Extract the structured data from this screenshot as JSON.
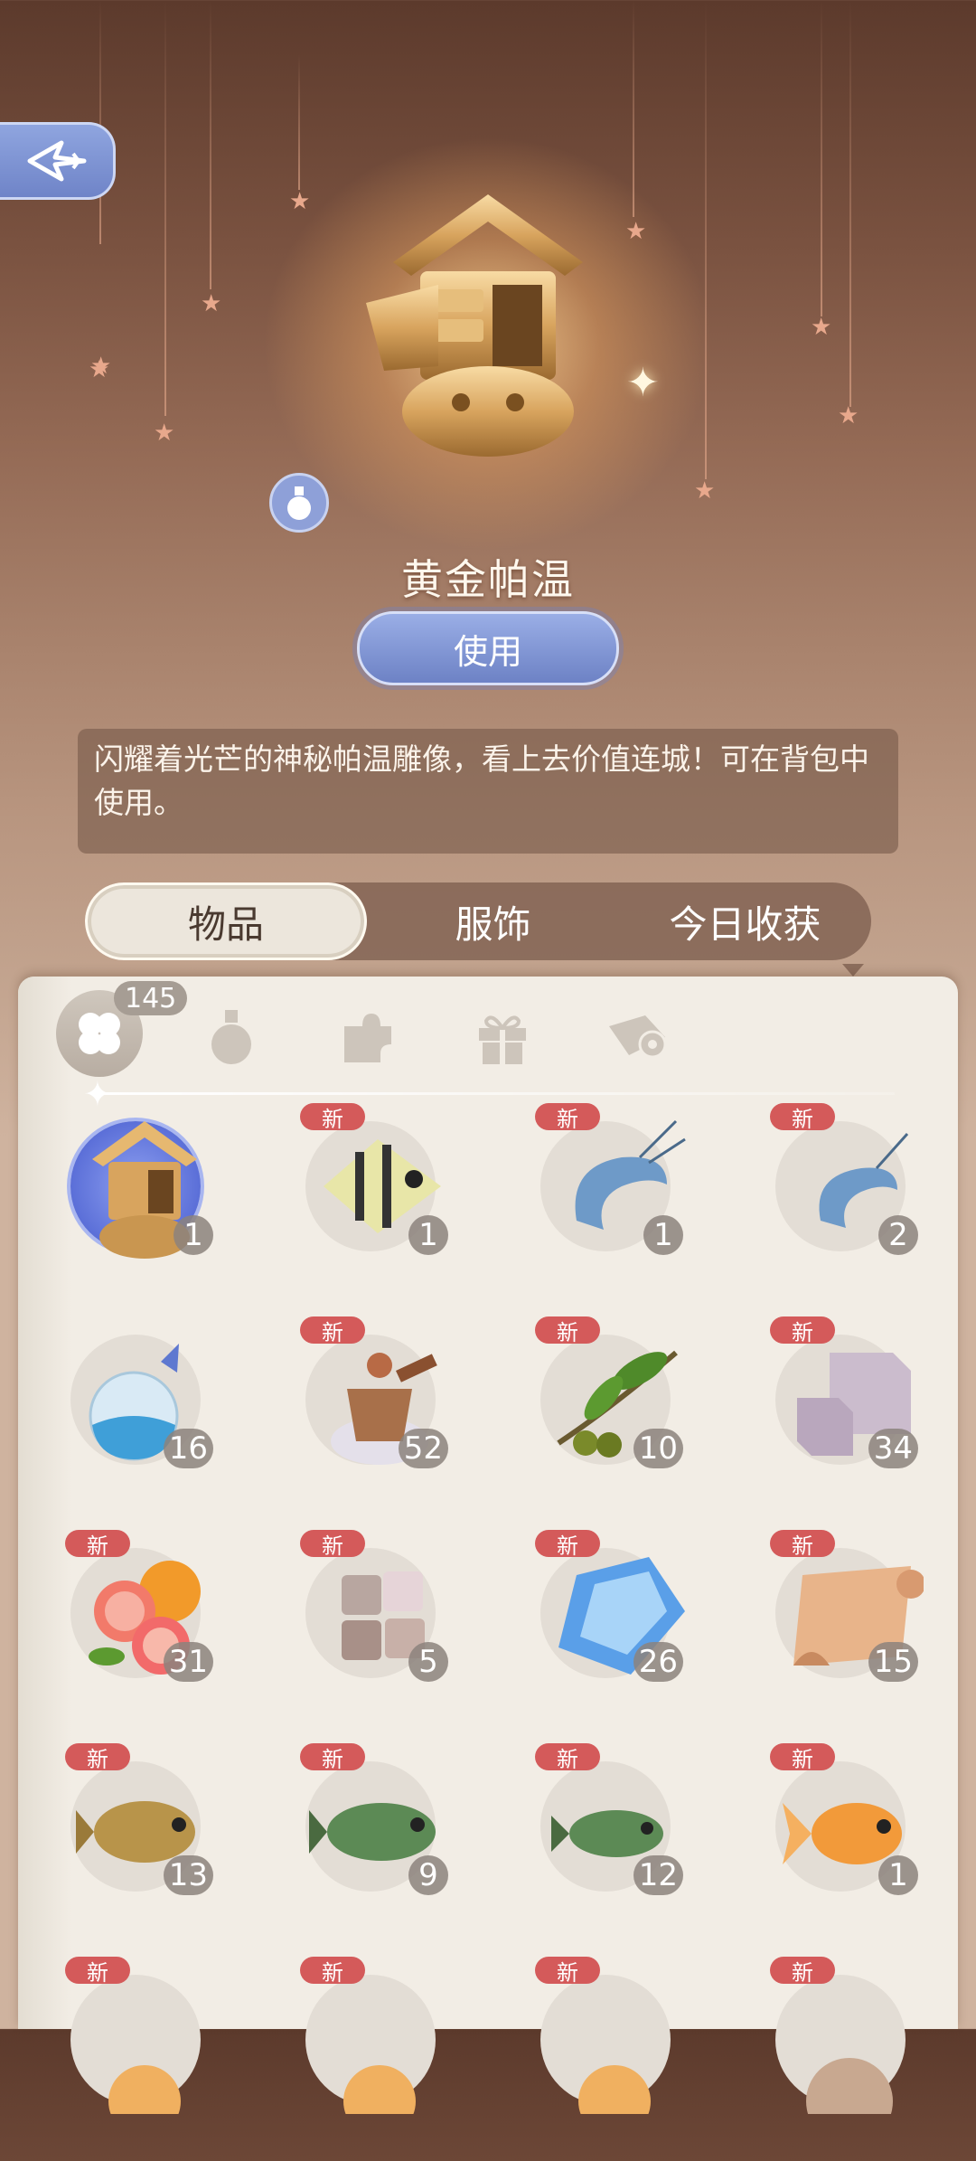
{
  "item": {
    "name": "黄金帕温",
    "use_label": "使用",
    "description": "闪耀着光芒的神秘帕温雕像，看上去价值连城！可在背包中使用。"
  },
  "tabs": [
    {
      "label": "物品",
      "active": true
    },
    {
      "label": "服饰",
      "active": false
    },
    {
      "label": "今日收获",
      "active": false
    }
  ],
  "category_bar": {
    "total_count": "145",
    "icons": [
      "clover-icon",
      "potion-icon",
      "puzzle-icon",
      "gift-icon",
      "scroll-icon"
    ]
  },
  "colors": {
    "accent_blue": "#7186cc",
    "new_tag": "#d45a5a",
    "panel": "#f2ede5"
  },
  "items": [
    {
      "icon": "golden-pawen-statue-icon",
      "qty": "1",
      "new": false,
      "selected": true
    },
    {
      "icon": "angelfish-icon",
      "qty": "1",
      "new": true
    },
    {
      "icon": "blue-shrimp-icon",
      "qty": "1",
      "new": true
    },
    {
      "icon": "small-blue-shrimp-icon",
      "qty": "2",
      "new": true
    },
    {
      "icon": "water-bubble-icon",
      "qty": "16",
      "new": false
    },
    {
      "icon": "mortar-pestle-icon",
      "qty": "52",
      "new": true
    },
    {
      "icon": "olive-branch-icon",
      "qty": "10",
      "new": true
    },
    {
      "icon": "crystal-cube-icon",
      "qty": "34",
      "new": true
    },
    {
      "icon": "grapefruit-icon",
      "qty": "31",
      "new": true
    },
    {
      "icon": "metal-cubes-icon",
      "qty": "5",
      "new": true
    },
    {
      "icon": "blue-gem-icon",
      "qty": "26",
      "new": true
    },
    {
      "icon": "parchment-icon",
      "qty": "15",
      "new": true
    },
    {
      "icon": "brown-fish-icon",
      "qty": "13",
      "new": true
    },
    {
      "icon": "green-bass-icon",
      "qty": "9",
      "new": true
    },
    {
      "icon": "small-bass-icon",
      "qty": "12",
      "new": true
    },
    {
      "icon": "goldfish-icon",
      "qty": "1",
      "new": true
    },
    {
      "icon": "partial-item-icon",
      "qty": "",
      "new": true
    },
    {
      "icon": "partial-item-icon",
      "qty": "",
      "new": true
    },
    {
      "icon": "partial-item-icon",
      "qty": "",
      "new": true
    },
    {
      "icon": "partial-creature-icon",
      "qty": "",
      "new": true
    }
  ],
  "new_tag_label": "新"
}
